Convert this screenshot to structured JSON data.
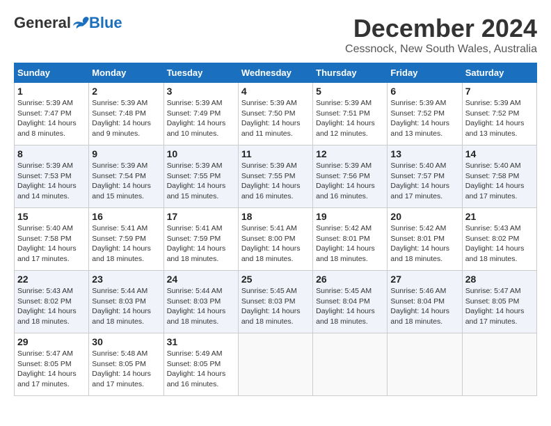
{
  "header": {
    "logo_general": "General",
    "logo_blue": "Blue",
    "month_title": "December 2024",
    "location": "Cessnock, New South Wales, Australia"
  },
  "calendar": {
    "days_of_week": [
      "Sunday",
      "Monday",
      "Tuesday",
      "Wednesday",
      "Thursday",
      "Friday",
      "Saturday"
    ],
    "weeks": [
      [
        null,
        {
          "day": 2,
          "sunrise": "5:39 AM",
          "sunset": "7:48 PM",
          "daylight": "14 hours and 9 minutes."
        },
        {
          "day": 3,
          "sunrise": "5:39 AM",
          "sunset": "7:49 PM",
          "daylight": "14 hours and 10 minutes."
        },
        {
          "day": 4,
          "sunrise": "5:39 AM",
          "sunset": "7:50 PM",
          "daylight": "14 hours and 11 minutes."
        },
        {
          "day": 5,
          "sunrise": "5:39 AM",
          "sunset": "7:51 PM",
          "daylight": "14 hours and 12 minutes."
        },
        {
          "day": 6,
          "sunrise": "5:39 AM",
          "sunset": "7:52 PM",
          "daylight": "14 hours and 13 minutes."
        },
        {
          "day": 7,
          "sunrise": "5:39 AM",
          "sunset": "7:52 PM",
          "daylight": "14 hours and 13 minutes."
        }
      ],
      [
        {
          "day": 1,
          "sunrise": "5:39 AM",
          "sunset": "7:47 PM",
          "daylight": "14 hours and 8 minutes."
        },
        {
          "day": 8,
          "sunrise": "5:39 AM",
          "sunset": "7:53 PM",
          "daylight": "14 hours and 14 minutes."
        },
        {
          "day": 9,
          "sunrise": "5:39 AM",
          "sunset": "7:54 PM",
          "daylight": "14 hours and 15 minutes."
        },
        {
          "day": 10,
          "sunrise": "5:39 AM",
          "sunset": "7:55 PM",
          "daylight": "14 hours and 15 minutes."
        },
        {
          "day": 11,
          "sunrise": "5:39 AM",
          "sunset": "7:55 PM",
          "daylight": "14 hours and 16 minutes."
        },
        {
          "day": 12,
          "sunrise": "5:39 AM",
          "sunset": "7:56 PM",
          "daylight": "14 hours and 16 minutes."
        },
        {
          "day": 13,
          "sunrise": "5:40 AM",
          "sunset": "7:57 PM",
          "daylight": "14 hours and 17 minutes."
        },
        {
          "day": 14,
          "sunrise": "5:40 AM",
          "sunset": "7:58 PM",
          "daylight": "14 hours and 17 minutes."
        }
      ],
      [
        {
          "day": 15,
          "sunrise": "5:40 AM",
          "sunset": "7:58 PM",
          "daylight": "14 hours and 17 minutes."
        },
        {
          "day": 16,
          "sunrise": "5:41 AM",
          "sunset": "7:59 PM",
          "daylight": "14 hours and 18 minutes."
        },
        {
          "day": 17,
          "sunrise": "5:41 AM",
          "sunset": "7:59 PM",
          "daylight": "14 hours and 18 minutes."
        },
        {
          "day": 18,
          "sunrise": "5:41 AM",
          "sunset": "8:00 PM",
          "daylight": "14 hours and 18 minutes."
        },
        {
          "day": 19,
          "sunrise": "5:42 AM",
          "sunset": "8:01 PM",
          "daylight": "14 hours and 18 minutes."
        },
        {
          "day": 20,
          "sunrise": "5:42 AM",
          "sunset": "8:01 PM",
          "daylight": "14 hours and 18 minutes."
        },
        {
          "day": 21,
          "sunrise": "5:43 AM",
          "sunset": "8:02 PM",
          "daylight": "14 hours and 18 minutes."
        }
      ],
      [
        {
          "day": 22,
          "sunrise": "5:43 AM",
          "sunset": "8:02 PM",
          "daylight": "14 hours and 18 minutes."
        },
        {
          "day": 23,
          "sunrise": "5:44 AM",
          "sunset": "8:03 PM",
          "daylight": "14 hours and 18 minutes."
        },
        {
          "day": 24,
          "sunrise": "5:44 AM",
          "sunset": "8:03 PM",
          "daylight": "14 hours and 18 minutes."
        },
        {
          "day": 25,
          "sunrise": "5:45 AM",
          "sunset": "8:03 PM",
          "daylight": "14 hours and 18 minutes."
        },
        {
          "day": 26,
          "sunrise": "5:45 AM",
          "sunset": "8:04 PM",
          "daylight": "14 hours and 18 minutes."
        },
        {
          "day": 27,
          "sunrise": "5:46 AM",
          "sunset": "8:04 PM",
          "daylight": "14 hours and 18 minutes."
        },
        {
          "day": 28,
          "sunrise": "5:47 AM",
          "sunset": "8:05 PM",
          "daylight": "14 hours and 17 minutes."
        }
      ],
      [
        {
          "day": 29,
          "sunrise": "5:47 AM",
          "sunset": "8:05 PM",
          "daylight": "14 hours and 17 minutes."
        },
        {
          "day": 30,
          "sunrise": "5:48 AM",
          "sunset": "8:05 PM",
          "daylight": "14 hours and 17 minutes."
        },
        {
          "day": 31,
          "sunrise": "5:49 AM",
          "sunset": "8:05 PM",
          "daylight": "14 hours and 16 minutes."
        },
        null,
        null,
        null,
        null
      ]
    ]
  }
}
